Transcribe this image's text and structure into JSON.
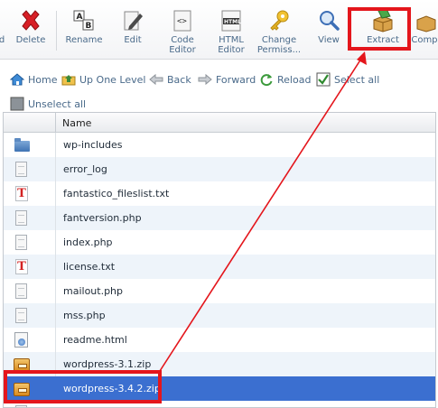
{
  "toolbar": {
    "buttons": [
      {
        "id": "d",
        "label": "d"
      },
      {
        "id": "delete",
        "label": "Delete"
      },
      {
        "id": "rename",
        "label": "Rename"
      },
      {
        "id": "edit",
        "label": "Edit"
      },
      {
        "id": "code_editor",
        "label1": "Code",
        "label2": "Editor"
      },
      {
        "id": "html_editor",
        "label1": "HTML",
        "label2": "Editor"
      },
      {
        "id": "change_perms",
        "label1": "Change",
        "label2": "Permiss..."
      },
      {
        "id": "view",
        "label": "View"
      },
      {
        "id": "extract",
        "label": "Extract"
      },
      {
        "id": "compress",
        "label": "Compr"
      }
    ],
    "html_icon_text": "HTML",
    "code_icon_text": "<>",
    "rename_icon_text1": "A",
    "rename_icon_text2": "B"
  },
  "nav": {
    "home": "Home",
    "up_one_level": "Up One Level",
    "back": "Back",
    "forward": "Forward",
    "reload": "Reload",
    "select_all": "Select all",
    "unselect_all": "Unselect all"
  },
  "table": {
    "name_header": "Name",
    "rows": [
      {
        "name": "wp-includes",
        "icon": "folder-icon"
      },
      {
        "name": "error_log",
        "icon": "file-icon"
      },
      {
        "name": "fantastico_fileslist.txt",
        "icon": "text-file-icon"
      },
      {
        "name": "fantversion.php",
        "icon": "file-icon"
      },
      {
        "name": "index.php",
        "icon": "file-icon"
      },
      {
        "name": "license.txt",
        "icon": "text-file-icon"
      },
      {
        "name": "mailout.php",
        "icon": "file-icon"
      },
      {
        "name": "mss.php",
        "icon": "file-icon"
      },
      {
        "name": "readme.html",
        "icon": "html-file-icon"
      },
      {
        "name": "wordpress-3.1.zip",
        "icon": "archive-icon"
      },
      {
        "name": "wordpress-3.4.2.zip",
        "icon": "archive-icon",
        "selected": true
      }
    ]
  },
  "colors": {
    "highlight": "#e4161c",
    "selected_row": "#3b6fd0",
    "label": "#4a6a8a"
  }
}
